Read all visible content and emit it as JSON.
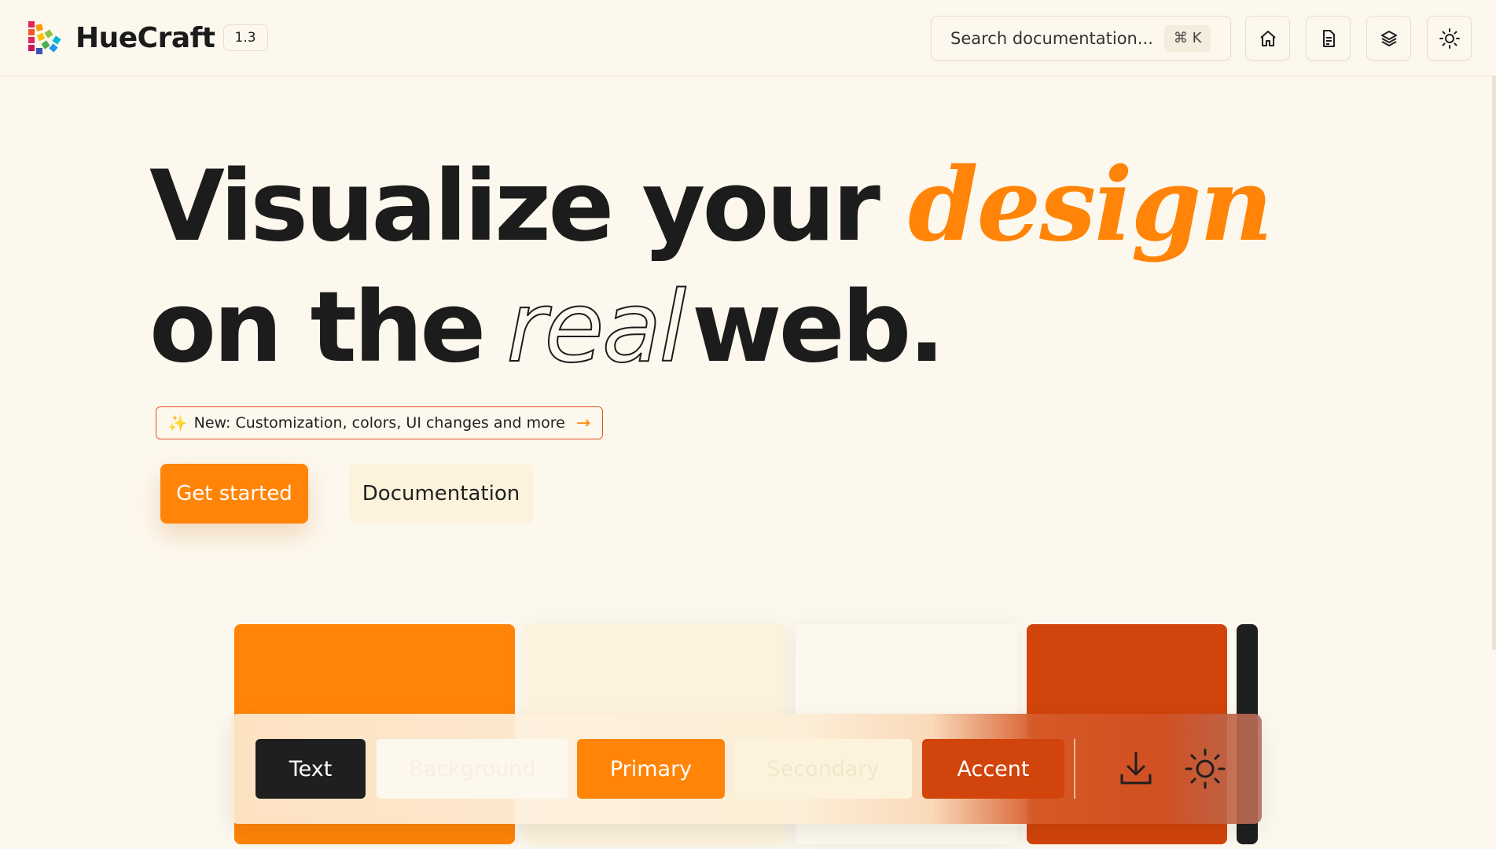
{
  "header": {
    "brand_name": "HueCraft",
    "version": "1.3",
    "search_placeholder": "Search documentation...",
    "search_shortcut": "⌘ K",
    "icons": [
      "home-icon",
      "document-icon",
      "layers-icon",
      "sun-icon"
    ]
  },
  "hero": {
    "line1_prefix": "Visualize your",
    "line1_accent": "design",
    "line2_prefix": "on the",
    "line2_outline": "real",
    "line2_suffix": "web.",
    "announcement": "New: Customization, colors, UI changes and more",
    "cta_primary": "Get started",
    "cta_secondary": "Documentation"
  },
  "palette": {
    "colors": {
      "text": "#1f1f1f",
      "background": "#fdf8ee",
      "primary": "#ff8408",
      "secondary": "#fdf3dc",
      "accent": "#d1440b"
    }
  },
  "toolbar": {
    "text_label": "Text",
    "background_label": "Background",
    "primary_label": "Primary",
    "secondary_label": "Secondary",
    "accent_label": "Accent",
    "icons": [
      "download-icon",
      "sun-icon"
    ]
  }
}
